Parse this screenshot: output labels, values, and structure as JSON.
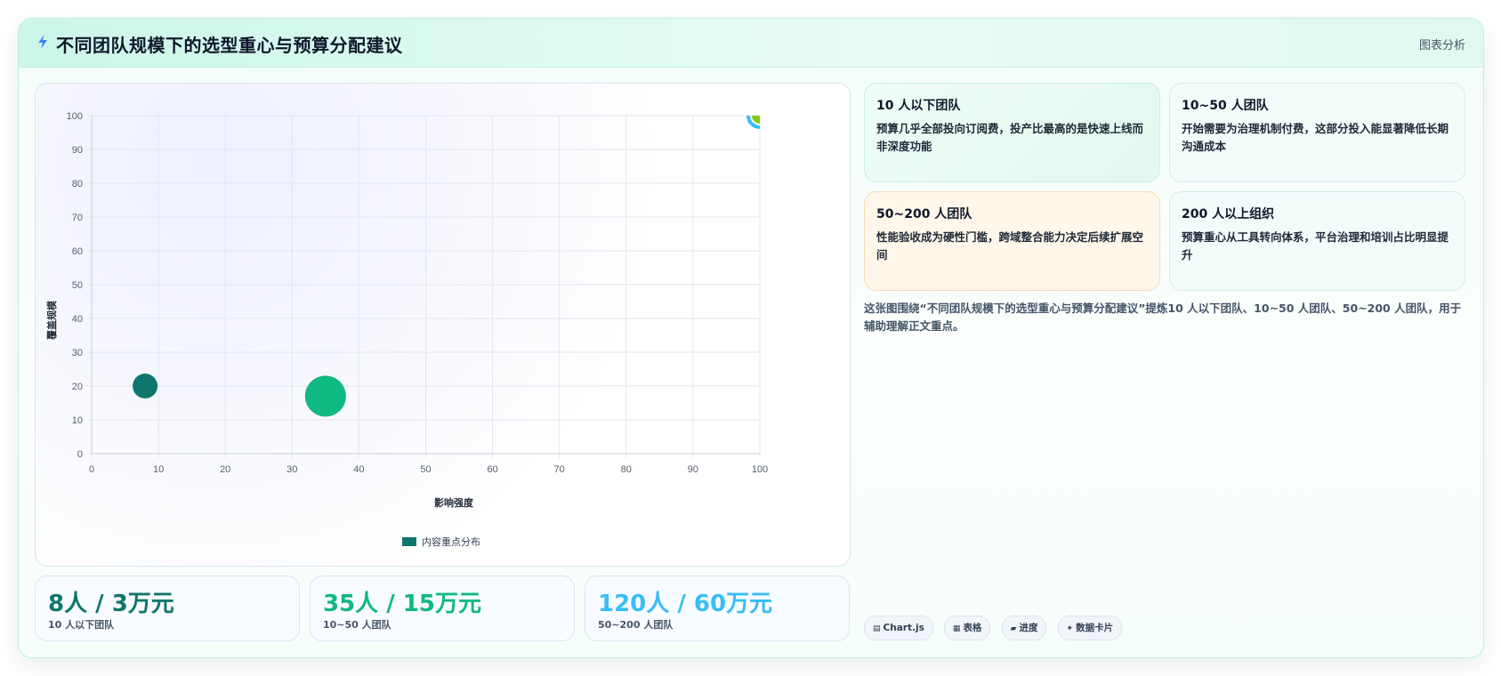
{
  "header": {
    "icon": "lightning-icon",
    "title": "不同团队规模下的选型重心与预算分配建议",
    "tag": "图表分析"
  },
  "chart_data": {
    "type": "bubble",
    "xlabel": "影响强度",
    "ylabel": "覆盖规模",
    "xlim": [
      0,
      100
    ],
    "ylim": [
      0,
      100
    ],
    "xticks": [
      0,
      10,
      20,
      30,
      40,
      50,
      60,
      70,
      80,
      90,
      100
    ],
    "yticks": [
      0,
      10,
      20,
      30,
      40,
      50,
      60,
      70,
      80,
      90,
      100
    ],
    "grid": true,
    "legend": {
      "label": "内容重点分布",
      "position": "bottom"
    },
    "points": [
      {
        "x": 8,
        "y": 20,
        "r": 14,
        "color": "#0f766e"
      },
      {
        "x": 35,
        "y": 17,
        "r": 23,
        "color": "#10b981"
      },
      {
        "x": 100,
        "y": 100,
        "r": 11,
        "color": "#84cc16",
        "stroke": "#38bdf8"
      }
    ]
  },
  "stats": [
    {
      "value": "8人 / 3万元",
      "label": "10 人以下团队",
      "color": "#0f766e"
    },
    {
      "value": "35人 / 15万元",
      "label": "10~50 人团队",
      "color": "#10b981"
    },
    {
      "value": "120人 / 60万元",
      "label": "50~200 人团队",
      "color": "#38bdf8"
    }
  ],
  "cards": [
    {
      "title": "10 人以下团队",
      "desc": "预算几乎全部投向订阅费，投产比最高的是快速上线而非深度功能"
    },
    {
      "title": "10~50 人团队",
      "desc": "开始需要为治理机制付费，这部分投入能显著降低长期沟通成本"
    },
    {
      "title": "50~200 人团队",
      "desc": "性能验收成为硬性门槛，跨域整合能力决定后续扩展空间"
    },
    {
      "title": "200 人以上组织",
      "desc": "预算重心从工具转向体系，平台治理和培训占比明显提升"
    }
  ],
  "description": "这张图围绕“不同团队规模下的选型重心与预算分配建议”提炼10 人以下团队、10~50 人团队、50~200 人团队，用于辅助理解正文重点。",
  "chips": [
    {
      "icon": "chart-icon",
      "label": "Chart.js"
    },
    {
      "icon": "table-icon",
      "label": "表格"
    },
    {
      "icon": "progress-icon",
      "label": "进度"
    },
    {
      "icon": "card-icon",
      "label": "数据卡片"
    }
  ]
}
